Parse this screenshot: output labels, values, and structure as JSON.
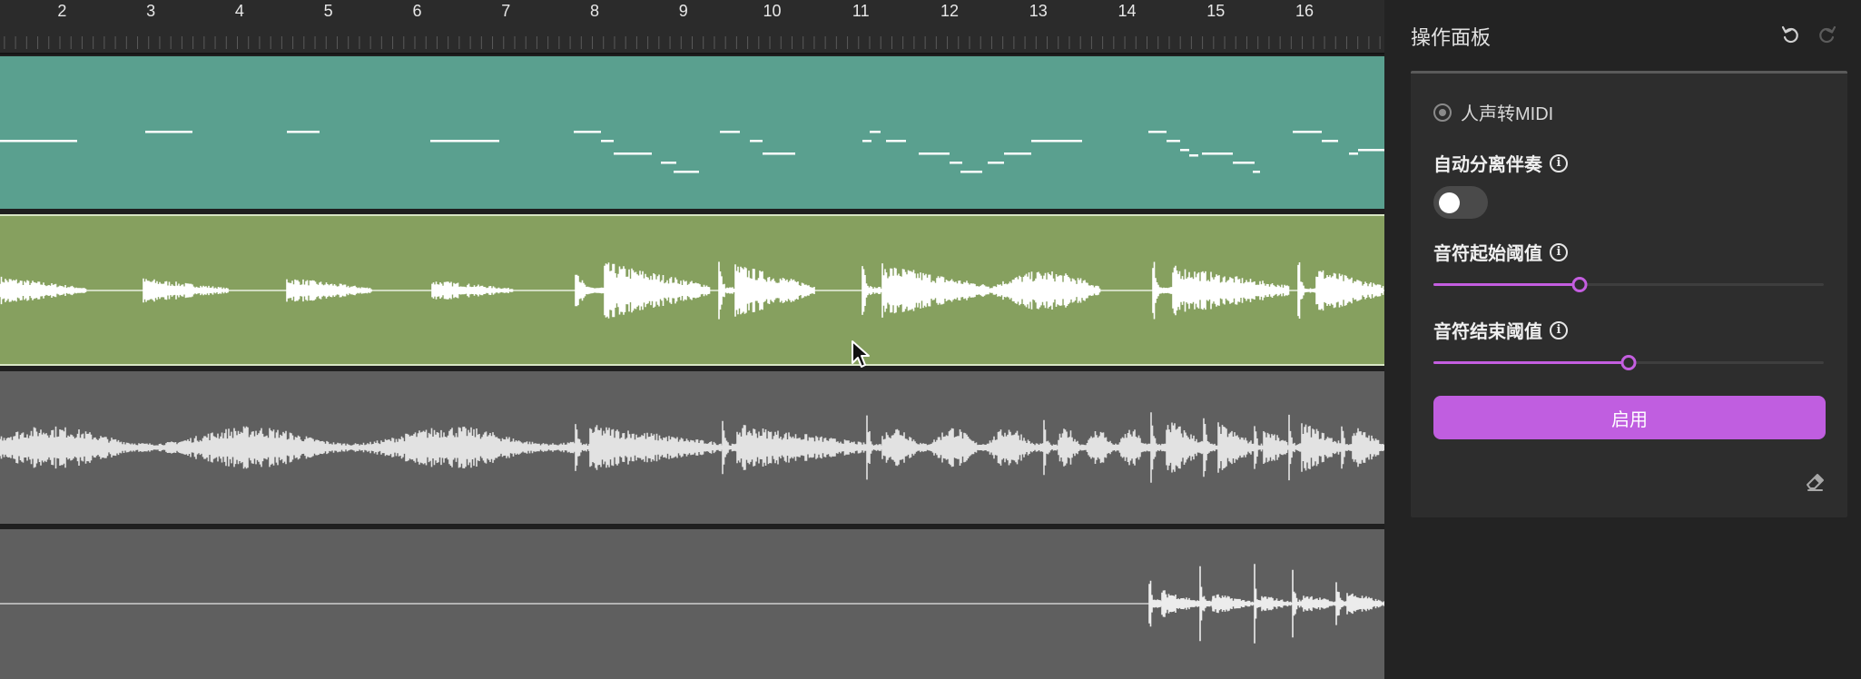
{
  "ruler": {
    "start_bar": 1.3,
    "end_bar": 16.9,
    "labels": [
      "2",
      "3",
      "4",
      "5",
      "6",
      "7",
      "8",
      "9",
      "10",
      "11",
      "12",
      "13",
      "14",
      "15",
      "16"
    ]
  },
  "tracks": [
    {
      "id": "midi",
      "kind": "midi",
      "color": "#5aa08f"
    },
    {
      "id": "vocal",
      "kind": "waveform",
      "color": "#86a05f"
    },
    {
      "id": "mix",
      "kind": "waveform",
      "color": "#5f5f5f"
    },
    {
      "id": "drums",
      "kind": "waveform",
      "color": "#5f5f5f"
    }
  ],
  "panel": {
    "title": "操作面板",
    "undo_icon": "undo-icon",
    "redo_icon": "redo-icon",
    "mode_label": "人声转MIDI",
    "auto_separate": {
      "label": "自动分离伴奏",
      "enabled": false
    },
    "onset_threshold": {
      "label": "音符起始阈值",
      "value": 0.375
    },
    "offset_threshold": {
      "label": "音符结束阈值",
      "value": 0.5
    },
    "apply_label": "启用",
    "info_glyph": "i",
    "accent_color": "#c05ee0"
  }
}
